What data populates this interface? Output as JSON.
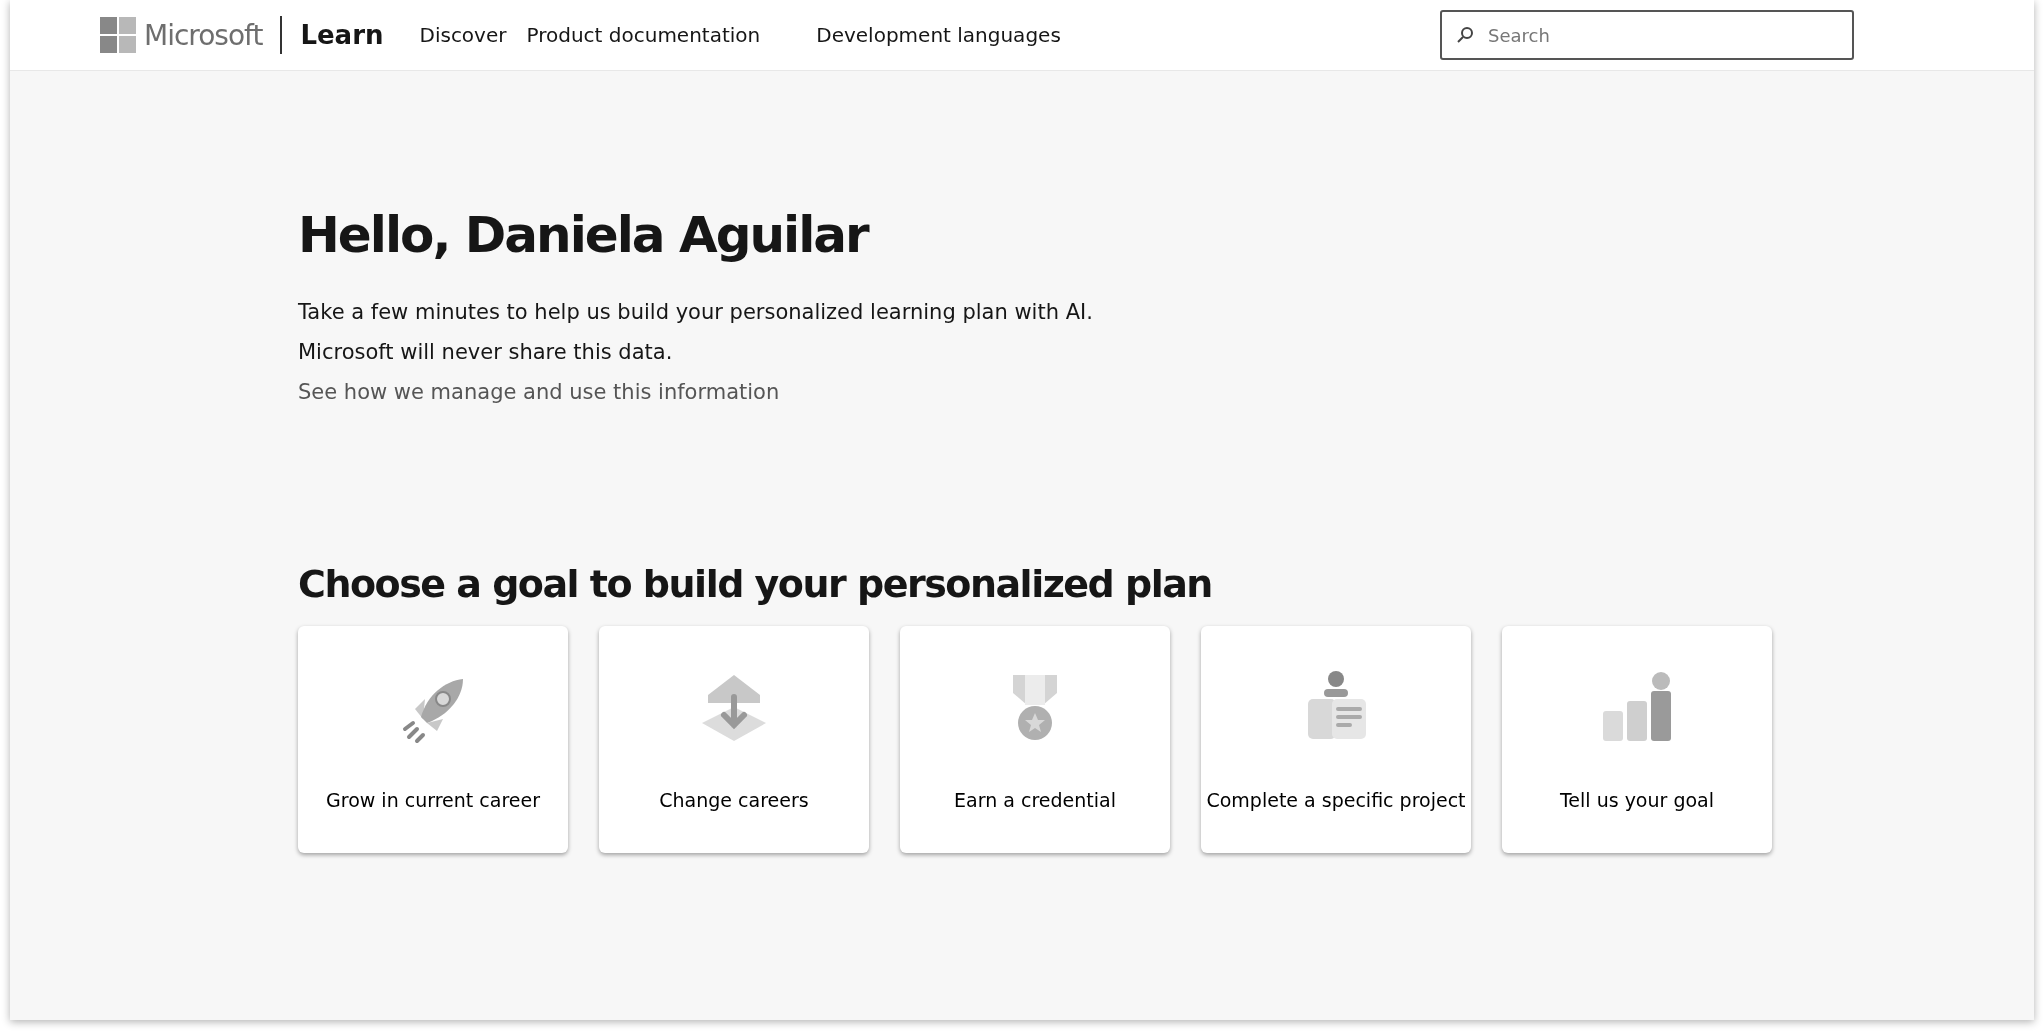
{
  "header": {
    "brand": "Microsoft",
    "product": "Learn",
    "nav": [
      {
        "label": "Discover"
      },
      {
        "label": "Product documentation"
      },
      {
        "label": "Development languages"
      }
    ],
    "search": {
      "placeholder": "Search"
    }
  },
  "greeting": {
    "title": "Hello, Daniela Aguilar",
    "text": "Take a few minutes to help us build your personalized learning plan with AI. Microsoft will never share this data.",
    "link": "See how we manage and use this information"
  },
  "goals": {
    "title": "Choose a goal to build your personalized plan",
    "cards": [
      {
        "kind": "rocket",
        "label": "Grow in current career"
      },
      {
        "kind": "download",
        "label": "Change careers"
      },
      {
        "kind": "medal",
        "label": "Earn a credential"
      },
      {
        "kind": "reader",
        "label": "Complete a specific project"
      },
      {
        "kind": "podium",
        "label": "Tell us your goal"
      }
    ]
  }
}
